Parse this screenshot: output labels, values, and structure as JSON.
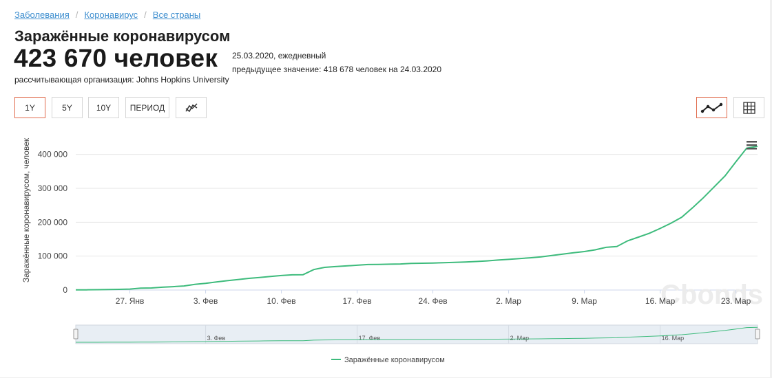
{
  "breadcrumb": [
    {
      "label": "Заболевания"
    },
    {
      "label": "Коронавирус"
    },
    {
      "label": "Все страны"
    }
  ],
  "header": {
    "title": "Заражённые коронавирусом",
    "value": "423 670 человек",
    "date_line": "25.03.2020, ежедневный",
    "previous_line": "предыдущее значение: 418 678 человек на 24.03.2020",
    "organization": "рассчитывающая организация: Johns Hopkins University"
  },
  "controls": {
    "range_buttons": [
      "1Y",
      "5Y",
      "10Y",
      "ПЕРИОД"
    ],
    "active_range": "1Y",
    "compare_icon": "compare-lines-icon",
    "line_view_icon": "line-chart-icon",
    "table_view_icon": "table-grid-icon",
    "menu_icon": "hamburger-menu-icon"
  },
  "colors": {
    "series": "#3dbb7c",
    "active_border": "#e0694a",
    "link": "#3f8fcf"
  },
  "watermark": "Cbonds",
  "chart_data": {
    "type": "line",
    "ylabel": "Заражённые коронавирусом, человек",
    "ylim": [
      0,
      450000
    ],
    "yticks": [
      "0",
      "100 000",
      "200 000",
      "300 000",
      "400 000"
    ],
    "xticks": [
      "27. Янв",
      "3. Фев",
      "10. Фев",
      "17. Фев",
      "24. Фев",
      "2. Мар",
      "9. Мар",
      "16. Мар",
      "23. Мар"
    ],
    "navigator_ticks": [
      "3. Фев",
      "17. Фев",
      "2. Мар",
      "16. Мар"
    ],
    "legend": "Заражённые коронавирусом",
    "grid": true,
    "series": [
      {
        "name": "Заражённые коронавирусом",
        "x": [
          "2020-01-22",
          "2020-01-23",
          "2020-01-24",
          "2020-01-25",
          "2020-01-26",
          "2020-01-27",
          "2020-01-28",
          "2020-01-29",
          "2020-01-30",
          "2020-01-31",
          "2020-02-01",
          "2020-02-02",
          "2020-02-03",
          "2020-02-04",
          "2020-02-05",
          "2020-02-06",
          "2020-02-07",
          "2020-02-08",
          "2020-02-09",
          "2020-02-10",
          "2020-02-11",
          "2020-02-12",
          "2020-02-13",
          "2020-02-14",
          "2020-02-15",
          "2020-02-16",
          "2020-02-17",
          "2020-02-18",
          "2020-02-19",
          "2020-02-20",
          "2020-02-21",
          "2020-02-22",
          "2020-02-23",
          "2020-02-24",
          "2020-02-25",
          "2020-02-26",
          "2020-02-27",
          "2020-02-28",
          "2020-02-29",
          "2020-03-01",
          "2020-03-02",
          "2020-03-03",
          "2020-03-04",
          "2020-03-05",
          "2020-03-06",
          "2020-03-07",
          "2020-03-08",
          "2020-03-09",
          "2020-03-10",
          "2020-03-11",
          "2020-03-12",
          "2020-03-13",
          "2020-03-14",
          "2020-03-15",
          "2020-03-16",
          "2020-03-17",
          "2020-03-18",
          "2020-03-19",
          "2020-03-20",
          "2020-03-21",
          "2020-03-22",
          "2020-03-23",
          "2020-03-24",
          "2020-03-25"
        ],
        "values": [
          555,
          654,
          941,
          1434,
          2118,
          2927,
          5578,
          6166,
          8234,
          9927,
          12038,
          16787,
          19881,
          23892,
          27635,
          30794,
          34391,
          37120,
          40150,
          42762,
          44802,
          45221,
          60368,
          66885,
          69030,
          71224,
          73258,
          75136,
          75639,
          76197,
          76819,
          78572,
          78958,
          79561,
          80406,
          81388,
          82746,
          84112,
          86011,
          88369,
          90306,
          92840,
          95120,
          97886,
          101800,
          105836,
          109835,
          113582,
          118582,
          125865,
          128343,
          145193,
          156097,
          167449,
          181546,
          197102,
          214821,
          242570,
          272208,
          304507,
          336953,
          378235,
          418678,
          423670
        ]
      }
    ]
  }
}
